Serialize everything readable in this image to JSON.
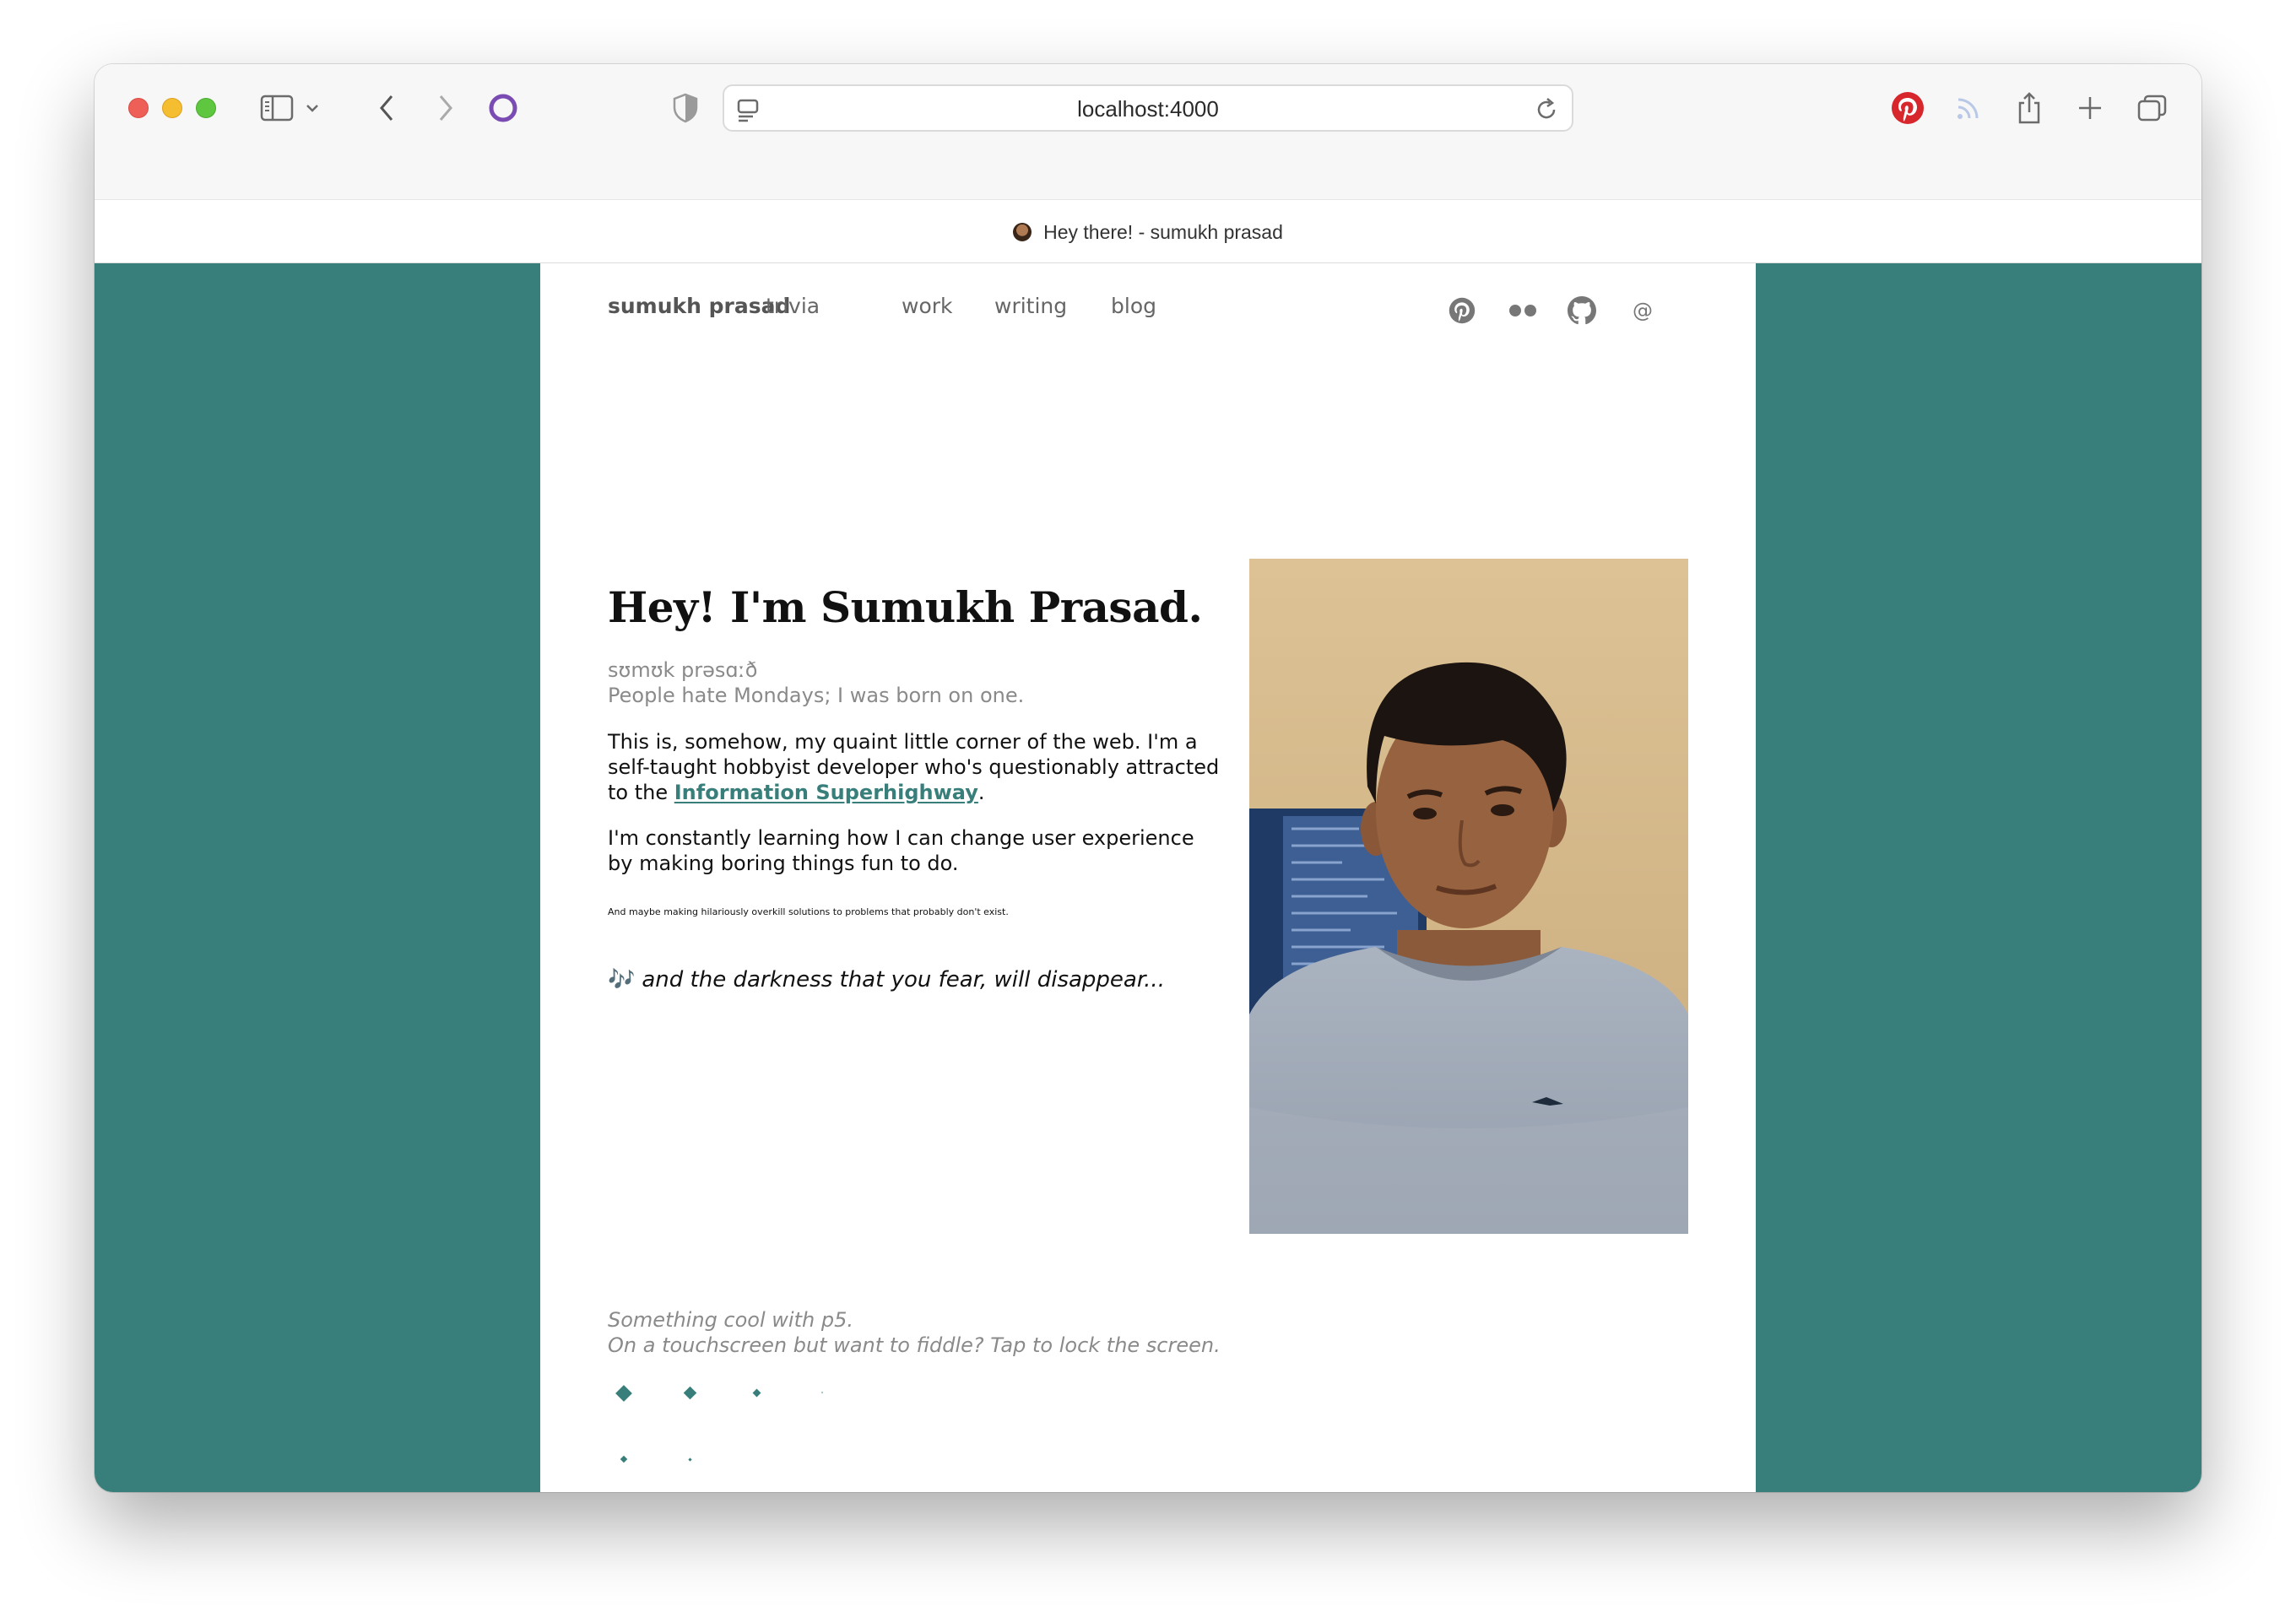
{
  "browser": {
    "url": "localhost:4000",
    "tab_title": "Hey there! - sumukh prasad",
    "toolbar_icons": [
      "sidebar-icon",
      "chevron-down-icon",
      "back-icon",
      "forward-icon",
      "extension-circle-icon",
      "shield-icon",
      "pinterest-icon",
      "rss-icon",
      "share-icon",
      "new-tab-icon",
      "tab-overview-icon"
    ],
    "colors": {
      "toolbar_bg": "#f7f7f7",
      "page_bg": "#387f7b"
    }
  },
  "site": {
    "brand": "sumukh prasad",
    "nav": [
      "trivia",
      "work",
      "writing",
      "blog"
    ],
    "social_icons": [
      "pinterest-icon",
      "flickr-icon",
      "github-icon",
      "email-icon"
    ],
    "email_symbol": "@",
    "accent": "#387f7b"
  },
  "hero": {
    "headline": "Hey! I'm Sumukh Prasad.",
    "pronunciation": "sʊmʊk prəsɑːð",
    "tagline": "People hate Mondays; I was born on one.",
    "para1_pre": "This is, somehow, my quaint little corner of the web. I'm a self-taught hobbyist developer who's questionably attracted to the ",
    "para1_link": "Information Superhighway",
    "para1_post": ".",
    "para2": "I'm constantly learning how I can change user experience by making boring things fun to do.",
    "tiny_note": "And maybe making hilariously overkill solutions to problems that probably don't exist.",
    "lyric_icon": "🎶",
    "lyric": "and the darkness that you fear, will disappear..."
  },
  "p5": {
    "line1": "Something cool with p5.",
    "line2": "On a touchscreen but want to fiddle? Tap to lock the screen."
  }
}
